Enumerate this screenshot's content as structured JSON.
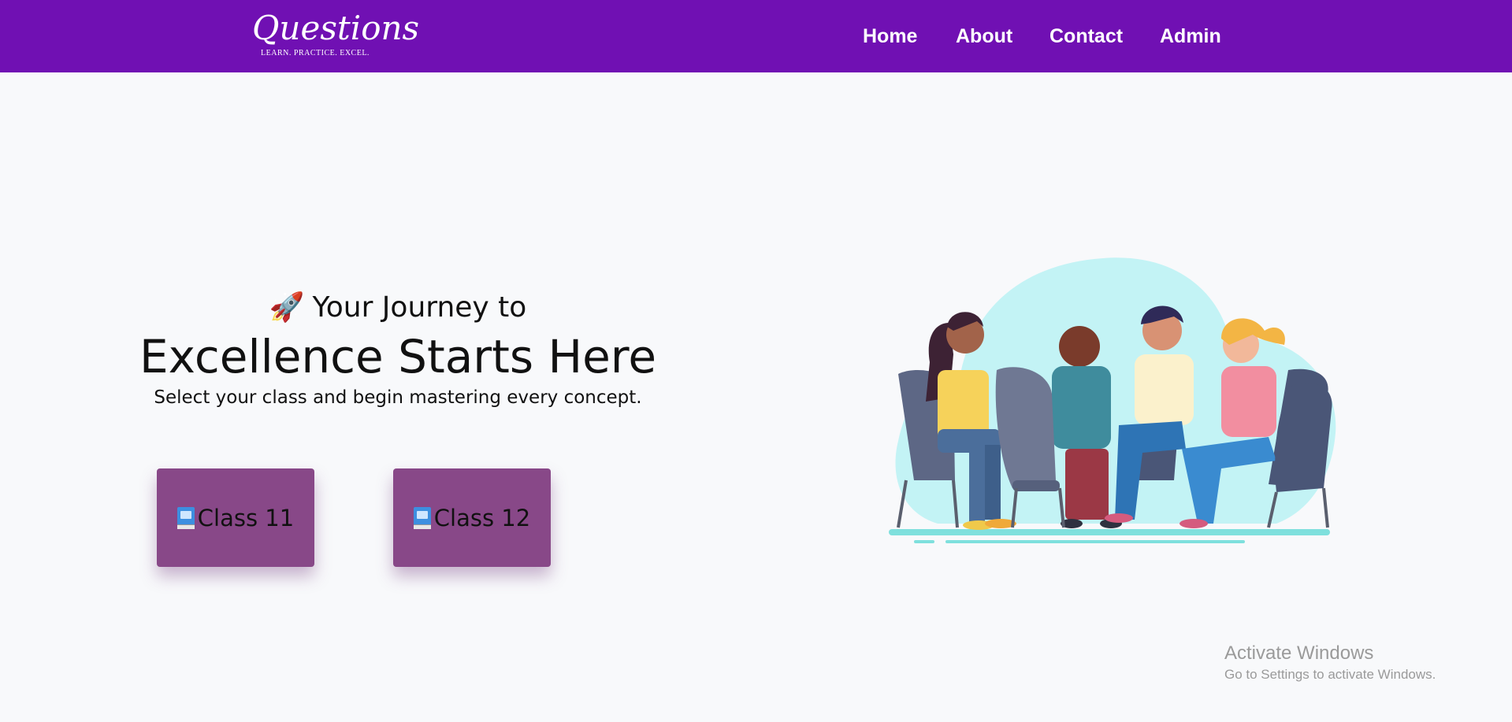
{
  "brand": {
    "name": "Questions",
    "tagline": "LEARN. PRACTICE. EXCEL."
  },
  "nav": {
    "items": [
      "Home",
      "About",
      "Contact",
      "Admin"
    ]
  },
  "hero": {
    "line1": "Your Journey to",
    "title": "Excellence Starts Here",
    "subtitle": "Select your class and begin mastering every concept.",
    "rocket_icon": "🚀"
  },
  "classes": [
    {
      "label": "Class 11",
      "icon": "book-icon"
    },
    {
      "label": "Class 12",
      "icon": "book-icon"
    }
  ],
  "illustration": {
    "description_icon": "group-discussion-illustration"
  },
  "watermark": {
    "title": "Activate Windows",
    "subtitle": "Go to Settings to activate Windows."
  },
  "colors": {
    "navbar": "#7010b3",
    "button": "#884888",
    "background": "#f8f9fb",
    "blob": "#c3f3f5"
  }
}
